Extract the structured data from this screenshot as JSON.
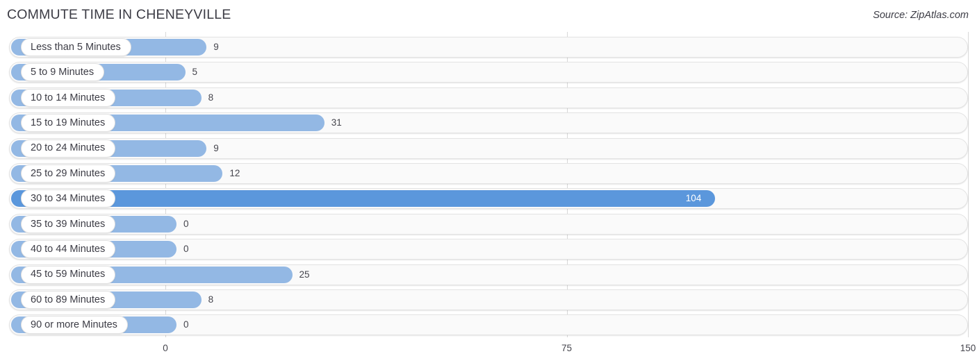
{
  "header": {
    "title": "COMMUTE TIME IN CHENEYVILLE",
    "source": "Source: ZipAtlas.com"
  },
  "colors": {
    "bar": "#93b8e4",
    "bar_highlight": "#5b97dc",
    "track": "#fafafa",
    "track_border": "#e3e3e3",
    "gridline": "#d8d8d8",
    "text": "#3c3c45",
    "value_inside": "#ffffff"
  },
  "chart_data": {
    "type": "bar",
    "orientation": "horizontal",
    "title": "COMMUTE TIME IN CHENEYVILLE",
    "xlabel": "",
    "ylabel": "",
    "xlim": [
      0,
      150
    ],
    "grid": true,
    "legend": null,
    "xticks": [
      0,
      75,
      150
    ],
    "xtick_labels": [
      "0",
      "75",
      "150"
    ],
    "categories": [
      "Less than 5 Minutes",
      "5 to 9 Minutes",
      "10 to 14 Minutes",
      "15 to 19 Minutes",
      "20 to 24 Minutes",
      "25 to 29 Minutes",
      "30 to 34 Minutes",
      "35 to 39 Minutes",
      "40 to 44 Minutes",
      "45 to 59 Minutes",
      "60 to 89 Minutes",
      "90 or more Minutes"
    ],
    "values": [
      9,
      5,
      8,
      31,
      9,
      12,
      104,
      0,
      0,
      25,
      8,
      0
    ],
    "value_labels": [
      "9",
      "5",
      "8",
      "31",
      "9",
      "12",
      "104",
      "0",
      "0",
      "25",
      "8",
      "0"
    ],
    "highlight_index": 6
  }
}
